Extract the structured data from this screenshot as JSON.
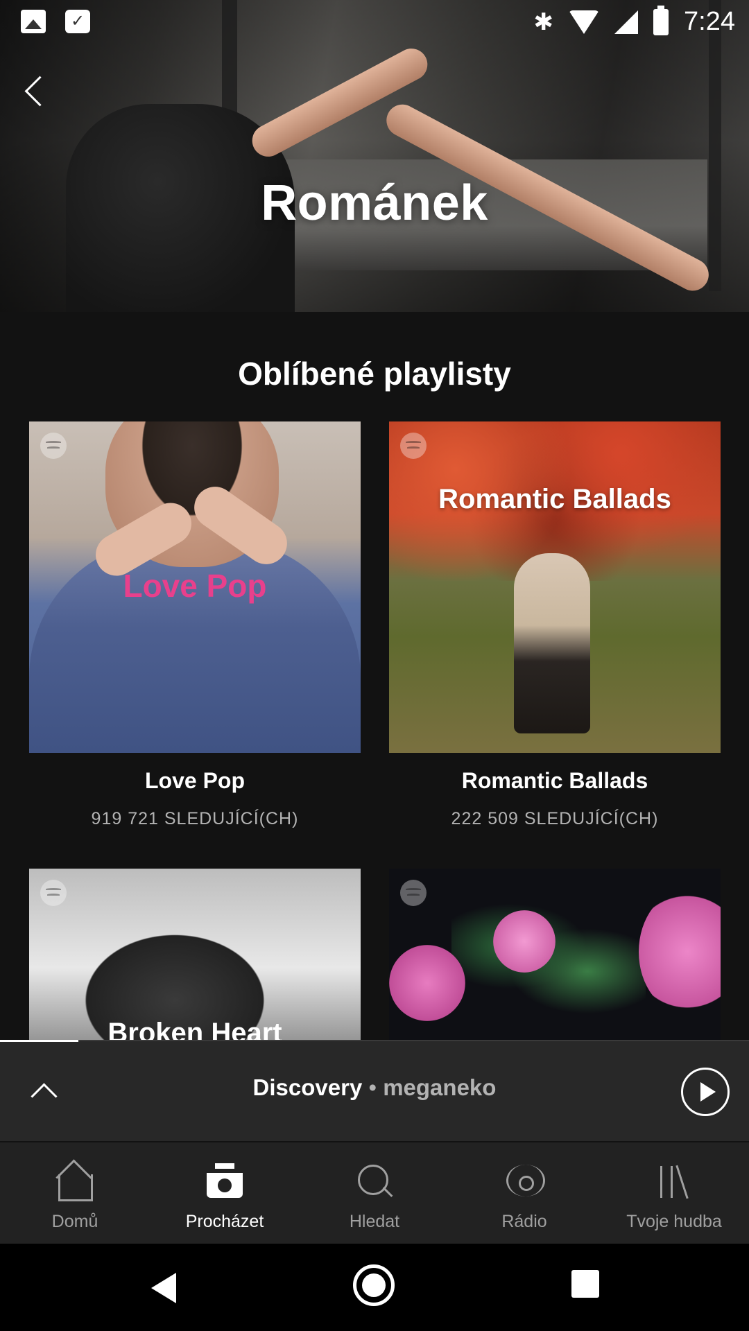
{
  "status_bar": {
    "time": "7:24",
    "left_icons": [
      "gallery-icon",
      "briefcase-check-icon"
    ],
    "right_icons": [
      "bluetooth-icon",
      "wifi-icon",
      "signal-icon",
      "battery-icon"
    ]
  },
  "header": {
    "title": "Románek",
    "back_icon": "chevron-left-icon"
  },
  "section": {
    "title": "Oblíbené playlisty"
  },
  "playlists": [
    {
      "name": "Love Pop",
      "followers": "919 721 SLEDUJÍCÍ(CH)",
      "cover_text": "Love Pop",
      "cover_text_color": "#e8408c"
    },
    {
      "name": "Romantic Ballads",
      "followers": "222 509 SLEDUJÍCÍ(CH)",
      "cover_text": "Romantic Ballads",
      "cover_text_color": "#ffffff"
    },
    {
      "name": "",
      "followers": "",
      "cover_text": "Broken Heart",
      "cover_text_color": "#ffffff"
    },
    {
      "name": "",
      "followers": "",
      "cover_text": "",
      "cover_text_color": ""
    }
  ],
  "mini_player": {
    "title": "Discovery",
    "separator": " • ",
    "artist": "meganeko",
    "expand_icon": "chevron-up-icon",
    "play_icon": "play-circle-icon"
  },
  "bottom_nav": {
    "items": [
      {
        "label": "Domů",
        "icon": "home-icon",
        "active": false
      },
      {
        "label": "Procházet",
        "icon": "browse-icon",
        "active": true
      },
      {
        "label": "Hledat",
        "icon": "search-icon",
        "active": false
      },
      {
        "label": "Rádio",
        "icon": "radio-icon",
        "active": false
      },
      {
        "label": "Tvoje hudba",
        "icon": "library-icon",
        "active": false
      }
    ]
  },
  "android_nav": [
    "back-triangle-icon",
    "home-circle-icon",
    "recents-square-icon"
  ],
  "colors": {
    "background": "#121212",
    "mini_player_bg": "#282828",
    "nav_bg": "#222222",
    "inactive_text": "#a0a0a0",
    "secondary_text": "#b3b3b3"
  }
}
